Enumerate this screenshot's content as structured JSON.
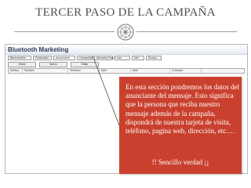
{
  "slide": {
    "title": "TERCER PASO DE LA CAMPAÑA"
  },
  "app": {
    "title": "Bluetooth Marketing",
    "tabs": [
      {
        "label": "Bienvenidos"
      },
      {
        "label": "Publicidad"
      },
      {
        "label": "Anunciante"
      },
      {
        "label": "Campaña"
      },
      {
        "label": "Memoria Flash"
      },
      {
        "label": "Lan"
      },
      {
        "label": "Net"
      },
      {
        "label": "Envios"
      }
    ],
    "toolbar": {
      "buttons": [
        {
          "label": "eNest"
        },
        {
          "label": "Nuevo"
        },
        {
          "label": "Editar"
        }
      ]
    },
    "grid": {
      "columns": [
        "Anilisa",
        "Nombre",
        "Telefono",
        "Web",
        "Mail",
        "Contacto"
      ]
    }
  },
  "callout": {
    "text": "En esta sección pondremos los datos del anunciante del mensaje. Esto significa que la persona que reciba nuestro mensaje además de la campaña, dispondrá de nuestra tarjeta de visita, teléfono, pagina web, dirección, etc.…",
    "footer": "!! Sencillo verdad ¡¡",
    "color": "#c9412e"
  },
  "colors": {
    "title_text": "#4f4f4f",
    "rule": "#9a9a9a"
  }
}
